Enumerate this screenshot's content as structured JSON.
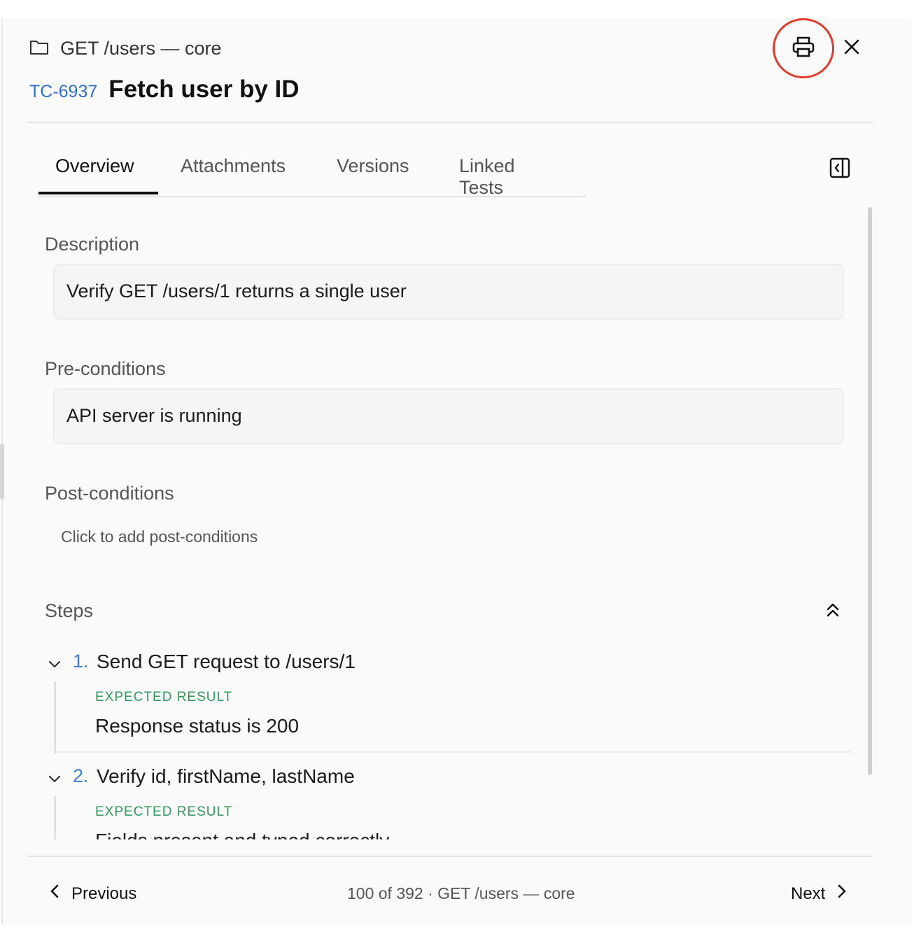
{
  "header": {
    "folder_icon": "folder-icon",
    "breadcrumb": "GET /users — core",
    "test_id": "TC-6937",
    "title": "Fetch user by ID",
    "print_icon": "printer-icon",
    "close_icon": "close-icon",
    "print_highlight_color": "#e23b2b"
  },
  "tabs": [
    {
      "label": "Overview",
      "active": true
    },
    {
      "label": "Attachments",
      "active": false
    },
    {
      "label": "Versions",
      "active": false
    },
    {
      "label": "Linked Tests",
      "active": false
    }
  ],
  "toolbar": {
    "sidebar_toggle_icon": "panel-collapse-icon"
  },
  "description": {
    "label": "Description",
    "value": "Verify GET /users/1 returns a single user"
  },
  "preconditions": {
    "label": "Pre-conditions",
    "value": "API server is running"
  },
  "postconditions": {
    "label": "Post-conditions",
    "placeholder": "Click to add post-conditions"
  },
  "steps": {
    "label": "Steps",
    "collapse_icon": "chevrons-up-icon",
    "items": [
      {
        "number": "1.",
        "action": "Send GET request to /users/1",
        "expected_label": "EXPECTED RESULT",
        "expected": "Response status is 200"
      },
      {
        "number": "2.",
        "action": "Verify id, firstName, lastName",
        "expected_label": "EXPECTED RESULT",
        "expected": "Fields present and typed correctly"
      }
    ]
  },
  "footer": {
    "previous_label": "Previous",
    "next_label": "Next",
    "position": "100 of 392 · GET /users — core"
  },
  "colors": {
    "accent_blue": "#2f6fd0",
    "expected_green": "#2e9b5a"
  }
}
